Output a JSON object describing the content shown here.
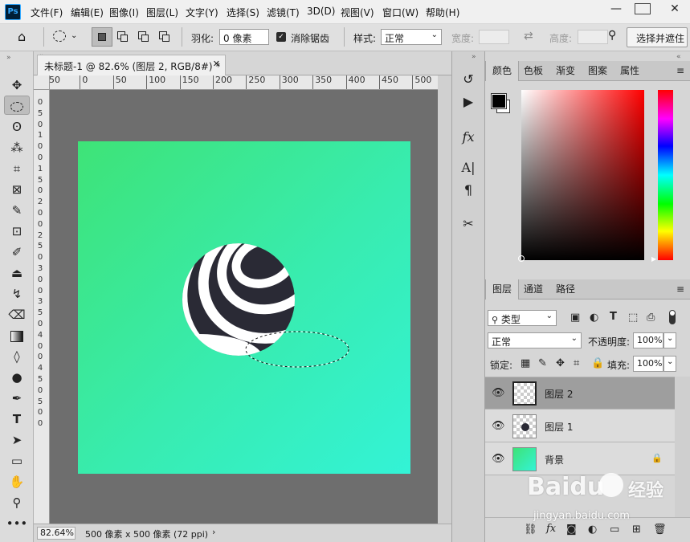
{
  "app": {
    "logo": "Ps"
  },
  "menu": [
    "文件(F)",
    "编辑(E)",
    "图像(I)",
    "图层(L)",
    "文字(Y)",
    "选择(S)",
    "滤镜(T)",
    "3D(D)",
    "视图(V)",
    "窗口(W)",
    "帮助(H)"
  ],
  "window_controls": {
    "minimize": "—",
    "maximize": "□",
    "close": "✕"
  },
  "options": {
    "feather_label": "羽化:",
    "feather_value": "0 像素",
    "antialias_label": "消除锯齿",
    "style_label": "样式:",
    "style_value": "正常",
    "width_label": "宽度:",
    "height_label": "高度:",
    "select_mask_button": "选择并遮住"
  },
  "document": {
    "tab_title": "未标题-1 @ 82.6% (图层 2, RGB/8#) *",
    "zoom": "82.64%",
    "doc_info": "500 像素 x 500 像素 (72 ppi)",
    "h_ruler": [
      "50",
      "0",
      "50",
      "100",
      "150",
      "200",
      "250",
      "300",
      "350",
      "400",
      "450",
      "500"
    ],
    "v_ruler": [
      "0",
      "5",
      "0",
      "1",
      "0",
      "0",
      "1",
      "5",
      "0",
      "2",
      "0",
      "0",
      "2",
      "5",
      "0",
      "3",
      "0",
      "0",
      "3",
      "5",
      "0",
      "4",
      "0",
      "0",
      "4",
      "5",
      "0",
      "5",
      "0",
      "0"
    ]
  },
  "color_panel": {
    "tabs": [
      "颜色",
      "色板",
      "渐变",
      "图案",
      "属性"
    ],
    "foreground": "#000000",
    "background": "#ffffff"
  },
  "layers_panel": {
    "tabs": [
      "图层",
      "通道",
      "路径"
    ],
    "filter_label": "类型",
    "blend_mode": "正常",
    "opacity_label": "不透明度:",
    "opacity_value": "100%",
    "lock_label": "锁定:",
    "fill_label": "填充:",
    "fill_value": "100%",
    "layers": [
      {
        "name": "图层 2",
        "selected": true
      },
      {
        "name": "图层 1",
        "selected": false
      },
      {
        "name": "背景",
        "selected": false,
        "locked": true
      }
    ]
  },
  "watermark": {
    "brand": "Baidu",
    "brand_cn": "经验",
    "url": "jingyan.baidu.com"
  }
}
